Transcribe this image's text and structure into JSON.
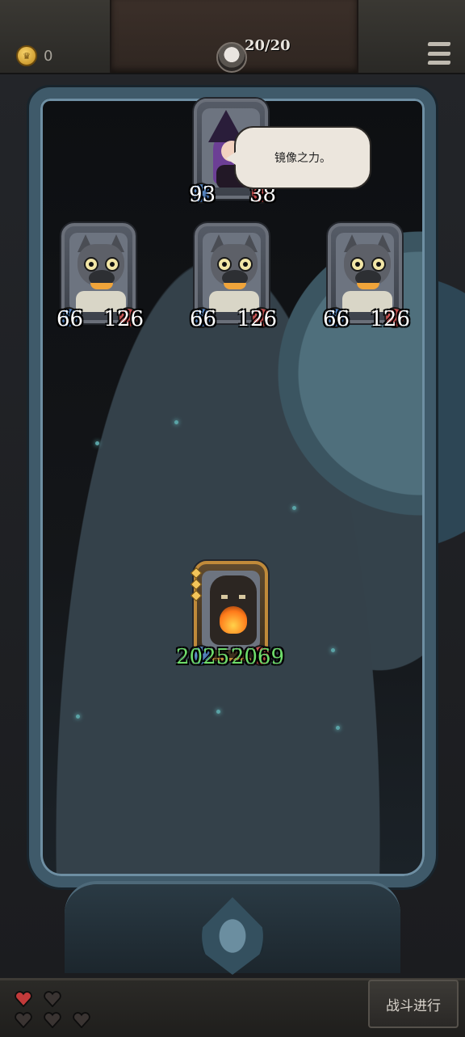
{
  "topbar": {
    "coin_icon": "crown-coin-icon",
    "coin_count": "0",
    "hp_text": "20/20",
    "menu_icon": "hamburger-menu-icon"
  },
  "enemy_boss": {
    "name": "witch",
    "attack": "93",
    "health": "38",
    "speech": "镜像之力。"
  },
  "enemy_minions": [
    {
      "name": "wolf",
      "attack": "66",
      "health": "126"
    },
    {
      "name": "wolf",
      "attack": "66",
      "health": "126"
    },
    {
      "name": "wolf",
      "attack": "66",
      "health": "126"
    }
  ],
  "player_card": {
    "name": "tree-monster",
    "attack": "2025",
    "health": "2069",
    "stat_color": "#6edc6a"
  },
  "bottombar": {
    "lives_total": 5,
    "lives_filled": 1,
    "end_turn_label": "战斗进行"
  }
}
